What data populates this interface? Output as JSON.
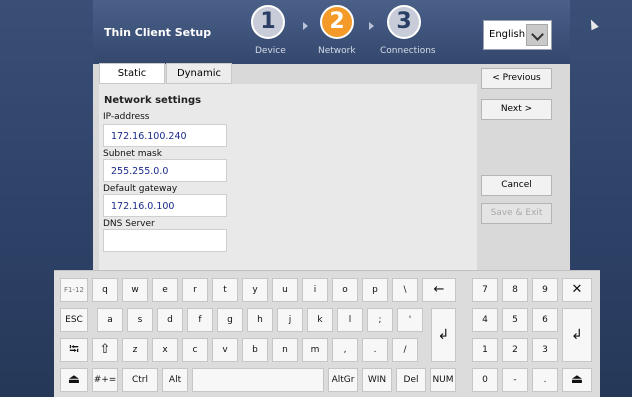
{
  "header": {
    "title": "Thin Client Setup"
  },
  "steps": [
    {
      "num": "1",
      "label": "Device"
    },
    {
      "num": "2",
      "label": "Network"
    },
    {
      "num": "3",
      "label": "Connections"
    }
  ],
  "language": {
    "value": "English"
  },
  "tabs": {
    "static": "Static",
    "dynamic": "Dynamic"
  },
  "section": "Network settings",
  "fields": {
    "ip": {
      "label": "IP-address",
      "value": "172.16.100.240"
    },
    "mask": {
      "label": "Subnet mask",
      "value": "255.255.0.0"
    },
    "gateway": {
      "label": "Default gateway",
      "value": "172.16.0.100"
    },
    "dns": {
      "label": "DNS Server",
      "value": ""
    }
  },
  "buttons": {
    "previous": "< Previous",
    "next": "Next >",
    "cancel": "Cancel",
    "save": "Save & Exit"
  },
  "keyboard": {
    "rows": [
      [
        "F1-12",
        "q",
        "w",
        "e",
        "r",
        "t",
        "y",
        "u",
        "i",
        "o",
        "p",
        "\\",
        "←"
      ],
      [
        "ESC",
        "a",
        "s",
        "d",
        "f",
        "g",
        "h",
        "j",
        "k",
        "l",
        ";",
        "'"
      ],
      [
        "⭾",
        "⇧",
        "z",
        "x",
        "c",
        "v",
        "b",
        "n",
        "m",
        ",",
        ".",
        "/"
      ],
      [
        "⏏",
        "#+=",
        "Ctrl",
        "Alt",
        "",
        "AltGr",
        "WIN",
        "Del",
        "NUM"
      ]
    ],
    "enter": "↲",
    "numpad": [
      [
        "7",
        "8",
        "9",
        "✕"
      ],
      [
        "4",
        "5",
        "6"
      ],
      [
        "1",
        "2",
        "3"
      ],
      [
        "0",
        "-",
        ".",
        "⏏"
      ]
    ],
    "numpad_enter": "↲"
  }
}
